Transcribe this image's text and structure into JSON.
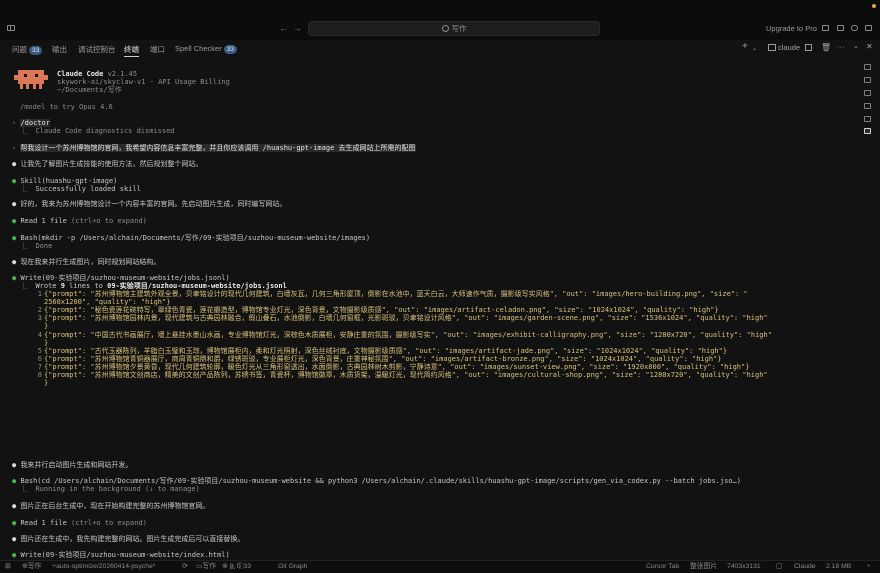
{
  "nav": {
    "search_label": "写作",
    "upgrade_label": "Upgrade to Pro"
  },
  "tabs": [
    {
      "label": "问题",
      "badge": "33"
    },
    {
      "label": "输出"
    },
    {
      "label": "调试控制台"
    },
    {
      "label": "终端",
      "active": true
    },
    {
      "label": "端口"
    },
    {
      "label": "Spell Checker",
      "badge": "33"
    }
  ],
  "terminal_controls": {
    "add": "+",
    "terminal_name": "claude",
    "more": "···"
  },
  "header": {
    "title": "Claude Code",
    "version": "v2.1.45",
    "account": "skywork-ai/skyclaw-v1 · API Usage Billing",
    "path": "~/Documents/写作",
    "tip": "/model to try Opus 4.6"
  },
  "transcript": {
    "doctor_cmd": "/doctor",
    "doctor_result": "Claude Code diagnostics dismissed",
    "user_prompt": "帮我设计一个苏州博物馆的官网，我希望内容信息丰富完整，并且你应该调用 /huashu-gpt-image 去生成网站上所需的配图",
    "m1": "让我先了解图片生成技能的使用方法，然后规划整个网站。",
    "skill_call": "Skill(huashu-gpt-image)",
    "skill_result": "Successfully loaded skill",
    "m2": "好的，我来为苏州博物馆设计一个内容丰富的官网。先启动图片生成，同时编写网站。",
    "read1": "Read 1 file",
    "read1_hint": "(ctrl+o to expand)",
    "bash1": "Bash(mkdir -p /Users/alchain/Documents/写作/09-实验项目/suzhou-museum-website/images)",
    "bash1_result": "Done",
    "m3": "现在我来并行生成图片，同时规划网站结构。",
    "write1": "Write(09-实验项目/suzhou-museum-website/jobs.jsonl)",
    "write1_summary_a": "Wrote ",
    "write1_summary_n": "9",
    "write1_summary_b": " lines to ",
    "write1_summary_path": "09-实验项目/suzhou-museum-website/jobs.jsonl",
    "code": [
      {
        "n": "1",
        "text": "{\"prompt\": \"苏州博物馆主建筑外观全景，贝聿铭设计的现代几何建筑，白墙灰瓦，几何三角形屋顶，倒影在水池中，蓝天白云，大师速作气质，摄影级写实风格\", \"out\": \"images/hero-building.png\", \"size\": \""
      },
      {
        "n": "",
        "text": "2560x1200\", \"quality\": \"high\"}"
      },
      {
        "n": "2",
        "text": "{\"prompt\": \"秘色瓷莲花碗特写，翠绿色青瓷，莲花瓣造型，博物馆专业灯光，深色背景，文物摄影级质感\", \"out\": \"images/artifact-celadon.png\", \"size\": \"1024x1024\", \"quality\": \"high\"}"
      },
      {
        "n": "3",
        "text": "{\"prompt\": \"苏州博物馆园林内景，现代建筑与古典园林融合，假山叠石，水池倒影，白墙几何窗框，光影斑驳，贝聿铭设计风格\", \"out\": \"images/garden-scene.png\", \"size\": \"1536x1024\", \"quality\": \"high\""
      },
      {
        "n": "",
        "text": "}"
      },
      {
        "n": "4",
        "text": "{\"prompt\": \"中国古代书画展厅，墙上悬挂水墨山水画，专业博物馆灯光，深棕色木质展柜，安静庄重的氛围，摄影级写实\", \"out\": \"images/exhibit-calligraphy.png\", \"size\": \"1280x720\", \"quality\": \"high\""
      },
      {
        "n": "",
        "text": "}"
      },
      {
        "n": "5",
        "text": "{\"prompt\": \"古代玉器陈列，羊脂白玉璧和玉琮，博物馆展柜内，柔和灯光照射，深色丝绒衬底，文物摄影级质感\", \"out\": \"images/artifact-jade.png\", \"size\": \"1024x1024\", \"quality\": \"high\"}"
      },
      {
        "n": "6",
        "text": "{\"prompt\": \"苏州博物馆青铜器展厅，商周青铜鼎和爵，绿锈斑驳，专业展柜灯光，深色背景，庄重神秘氛围\", \"out\": \"images/artifact-bronze.png\", \"size\": \"1024x1024\", \"quality\": \"high\"}"
      },
      {
        "n": "7",
        "text": "{\"prompt\": \"苏州博物馆夕景黄昏，现代几何建筑轮廓，暖色灯光从三角形窗透出，水面倒影，古典园林树木剪影，宁静诗意\", \"out\": \"images/sunset-view.png\", \"size\": \"1920x800\", \"quality\": \"high\"}"
      },
      {
        "n": "8",
        "text": "{\"prompt\": \"苏州博物馆文创商店，精美的文创产品陈列，苏绣书签，青瓷杯，博物馆徽章，木质货架，温暖灯光，现代简约风格\", \"out\": \"images/cultural-shop.png\", \"size\": \"1280x720\", \"quality\": \"high\""
      },
      {
        "n": "",
        "text": "}"
      }
    ],
    "m4": "我来并行启动图片生成和网站开发。",
    "bash2": "Bash(cd /Users/alchain/Documents/写作/09-实验项目/suzhou-museum-website && python3 /Users/alchain/.claude/skills/huashu-gpt-image/scripts/gen_via_codex.py --batch jobs.jso…)",
    "bash2_result": "Running in the background (↓ to manage)",
    "m5": "图片正在后台生成中，现在开始构建完整的苏州博物馆官网。",
    "read2": "Read 1 file",
    "read2_hint": "(ctrl+o to expand)",
    "m6": "图片还在生成中，我先构建完整的网站。图片生成完成后可以直接替换。",
    "write2": "Write(09-实验项目/suzhou-museum-website/index.html)"
  },
  "status": {
    "branch": "写作",
    "branch_detail": "auto-optimize/20260414-psyche*",
    "folder": "写作",
    "errors": "0",
    "warnings": "0",
    "info": "33",
    "git_graph": "Git Graph",
    "cursor_tab": "Cursor Tab",
    "image_tool": "整张图片",
    "dimensions": "7403x3131",
    "agent": "Claude",
    "size": "2.18 MB"
  },
  "colors": {
    "background": "#121212",
    "bullet_green": "#3fb950",
    "badge": "#3d5a80",
    "mascot": "#d97757"
  }
}
